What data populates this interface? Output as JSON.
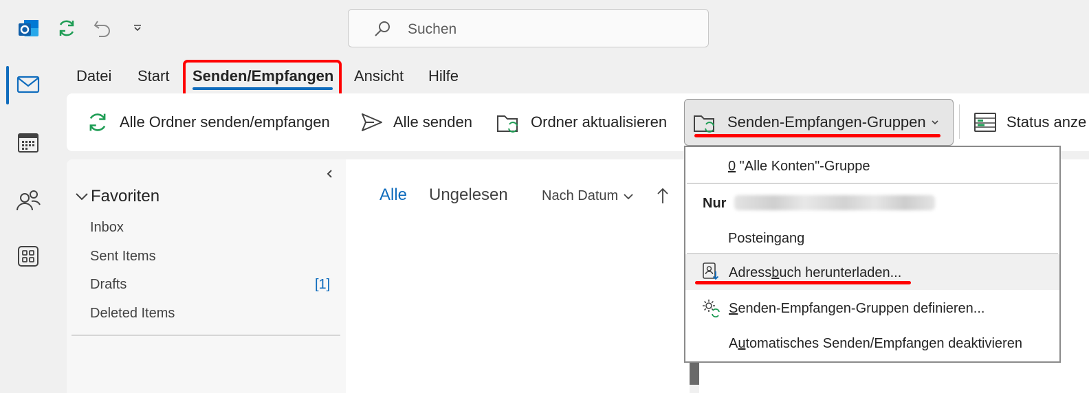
{
  "title_bar": {
    "search_placeholder": "Suchen"
  },
  "menu_tabs": [
    {
      "label": "Datei"
    },
    {
      "label": "Start"
    },
    {
      "label": "Senden/Empfangen",
      "selected": true
    },
    {
      "label": "Ansicht"
    },
    {
      "label": "Hilfe"
    }
  ],
  "ribbon": {
    "send_receive_all": "Alle Ordner senden/empfangen",
    "send_all": "Alle senden",
    "update_folder": "Ordner aktualisieren",
    "groups": "Senden-Empfangen-Gruppen",
    "status": "Status anze"
  },
  "folders": {
    "favorites_label": "Favoriten",
    "items": [
      {
        "label": "Inbox"
      },
      {
        "label": "Sent Items"
      },
      {
        "label": "Drafts",
        "badge": "[1]"
      },
      {
        "label": "Deleted Items"
      }
    ]
  },
  "message_list": {
    "tab_all": "Alle",
    "tab_unread": "Ungelesen",
    "sort": "Nach Datum"
  },
  "dropdown_menu": {
    "all_accounts_num": "0",
    "all_accounts_text": " \"Alle Konten\"-Gruppe",
    "only_label": "Nur",
    "inbox": "Posteingang",
    "address_book_pre": "Adress",
    "address_book_key": "b",
    "address_book_post": "uch herunterladen...",
    "define_key": "S",
    "define_post": "enden-Empfangen-Gruppen definieren...",
    "auto_pre": "A",
    "auto_key": "u",
    "auto_post": "tomatisches Senden/Empfangen deaktivieren"
  },
  "colors": {
    "accent_blue": "#0f6cbd",
    "sync_green": "#1f9d55",
    "annotation_red": "#ff0000"
  }
}
